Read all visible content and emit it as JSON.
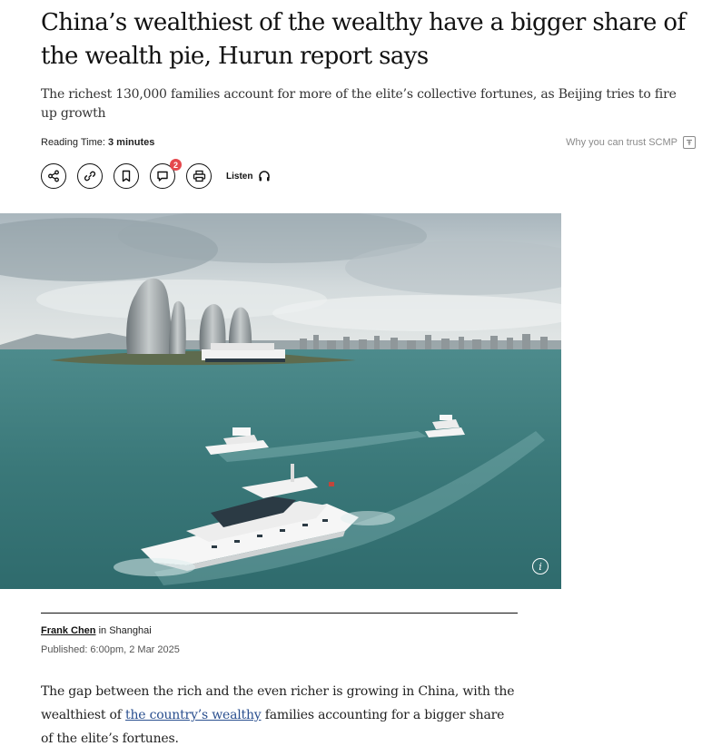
{
  "article": {
    "headline": "China’s wealthiest of the wealthy have a bigger share of the wealth pie, Hurun report says",
    "subheadline": "The richest 130,000 families account for more of the elite’s collective fortunes, as Beijing tries to fire up growth",
    "reading_time_label": "Reading Time:",
    "reading_time_value": "3 minutes",
    "trust_link": "Why you can trust SCMP",
    "actions": {
      "comment_count": "2",
      "listen_label": "Listen"
    },
    "hero_image": {
      "info_glyph": "i"
    },
    "byline": {
      "author": "Frank Chen",
      "location_prefix": " in ",
      "location": "Shanghai",
      "published": "Published: 6:00pm, 2 Mar 2025"
    },
    "body": {
      "p1_before": "The gap between the rich and the even richer is growing in China, with the wealthiest of ",
      "p1_link": "the country’s wealthy",
      "p1_after": " families accounting for a bigger share of the elite’s fortunes."
    }
  },
  "icons": [
    "share-icon",
    "link-icon",
    "bookmark-icon",
    "comment-icon",
    "print-icon",
    "headphones-icon",
    "info-icon",
    "trust-icon"
  ],
  "colors": {
    "badge": "#e5484d",
    "link": "#2a4f8f",
    "sea": "#3f7f80"
  }
}
